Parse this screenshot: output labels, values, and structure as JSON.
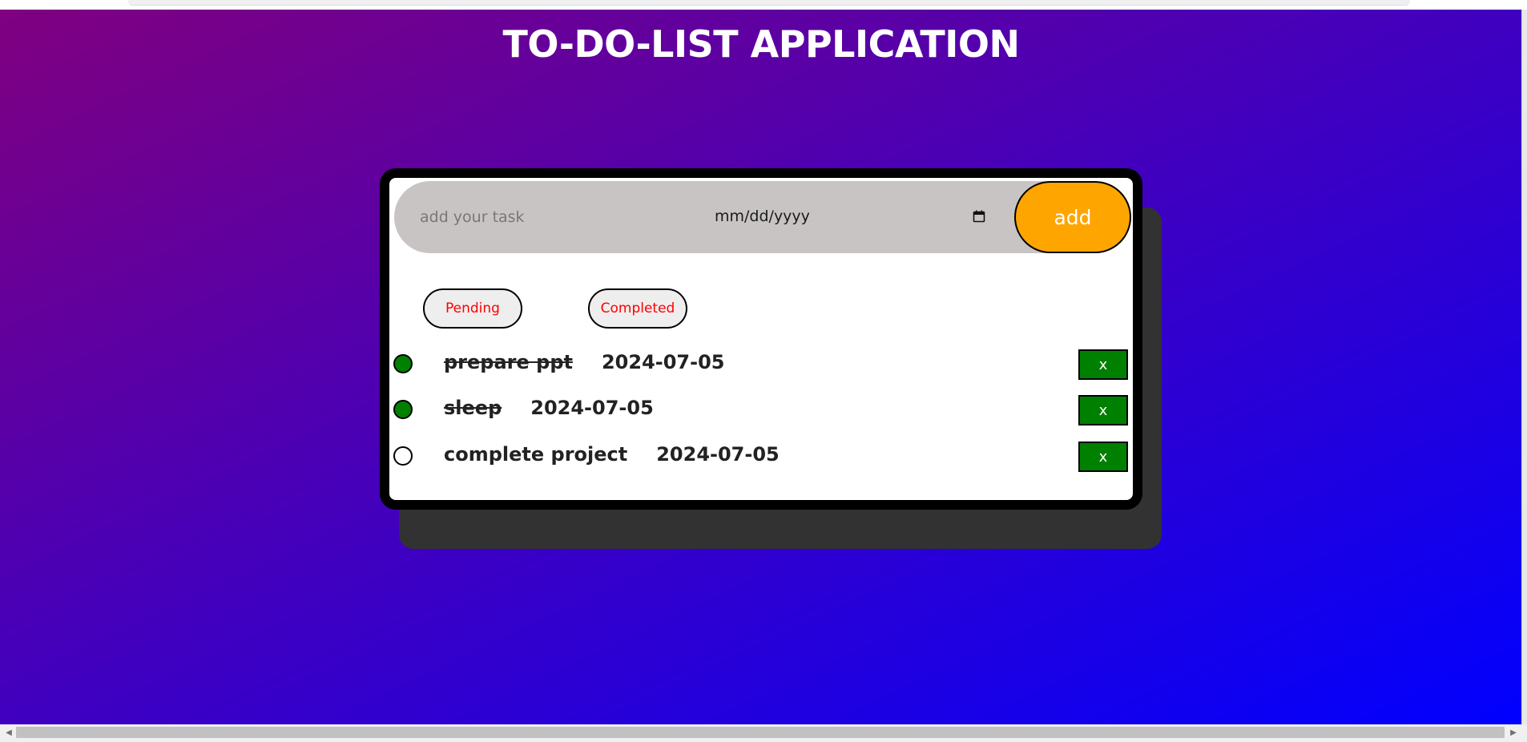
{
  "app": {
    "title": "TO-DO-LIST APPLICATION"
  },
  "form": {
    "task_placeholder": "add your task",
    "date_placeholder": "mm/dd/yyyy",
    "add_label": "add"
  },
  "filters": {
    "pending_label": "Pending",
    "completed_label": "Completed"
  },
  "tasks": [
    {
      "text": "prepare ppt",
      "date": "2024-07-05",
      "completed": true,
      "delete_label": "x"
    },
    {
      "text": "sleep",
      "date": "2024-07-05",
      "completed": true,
      "delete_label": "x"
    },
    {
      "text": "complete project",
      "date": "2024-07-05",
      "completed": false,
      "delete_label": "x"
    }
  ],
  "icons": {
    "calendar": "calendar-icon",
    "scroll_left": "scroll-left-arrow-icon",
    "scroll_right": "scroll-right-arrow-icon"
  },
  "colors": {
    "background_start": "#800080",
    "background_end": "#0000ff",
    "add_button": "#ffa500",
    "filter_text": "#ff0000",
    "completed_check": "#008000",
    "delete_button": "#008000",
    "input_bar": "#c9c4c4",
    "card_shadow": "#323232"
  }
}
